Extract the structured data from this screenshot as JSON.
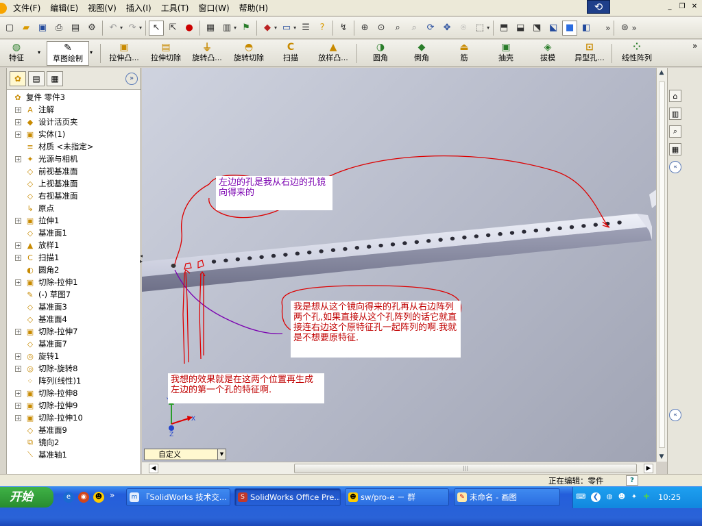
{
  "menubar": {
    "items": [
      "文件(F)",
      "编辑(E)",
      "视图(V)",
      "插入(I)",
      "工具(T)",
      "窗口(W)",
      "帮助(H)"
    ]
  },
  "window": {
    "minimize": "_",
    "restore": "❐",
    "close": "✕"
  },
  "features": {
    "tab_features": "特征",
    "tab_sketch": "草图绘制",
    "extrude_boss": "拉伸凸...",
    "extrude_cut": "拉伸切除",
    "revolve_boss": "旋转凸...",
    "revolve_cut": "旋转切除",
    "sweep": "扫描",
    "loft": "放样凸...",
    "fillet": "圆角",
    "chamfer": "倒角",
    "rib": "筋",
    "shell": "抽壳",
    "draft": "拔模",
    "hole_wizard": "异型孔...",
    "linear_pattern": "线性阵列"
  },
  "tree": {
    "root": "复件 零件3",
    "items": [
      {
        "label": "注解",
        "expand": true,
        "icon": "A"
      },
      {
        "label": "设计活页夹",
        "expand": true,
        "icon": "◆"
      },
      {
        "label": "实体(1)",
        "expand": true,
        "icon": "▣"
      },
      {
        "label": "材质 <未指定>",
        "expand": false,
        "icon": "≡"
      },
      {
        "label": "光源与相机",
        "expand": true,
        "icon": "✦"
      },
      {
        "label": "前视基准面",
        "expand": false,
        "icon": "◇"
      },
      {
        "label": "上视基准面",
        "expand": false,
        "icon": "◇"
      },
      {
        "label": "右视基准面",
        "expand": false,
        "icon": "◇"
      },
      {
        "label": "原点",
        "expand": false,
        "icon": "↳"
      },
      {
        "label": "拉伸1",
        "expand": true,
        "icon": "▣"
      },
      {
        "label": "基准面1",
        "expand": false,
        "icon": "◇"
      },
      {
        "label": "放样1",
        "expand": true,
        "icon": "▲"
      },
      {
        "label": "扫描1",
        "expand": true,
        "icon": "C"
      },
      {
        "label": "圆角2",
        "expand": false,
        "icon": "◐"
      },
      {
        "label": "切除-拉伸1",
        "expand": true,
        "icon": "▣"
      },
      {
        "label": "(-) 草图7",
        "expand": false,
        "icon": "✎"
      },
      {
        "label": "基准面3",
        "expand": false,
        "icon": "◇"
      },
      {
        "label": "基准面4",
        "expand": false,
        "icon": "◇"
      },
      {
        "label": "切除-拉伸7",
        "expand": true,
        "icon": "▣"
      },
      {
        "label": "基准面7",
        "expand": false,
        "icon": "◇"
      },
      {
        "label": "旋转1",
        "expand": true,
        "icon": "◎"
      },
      {
        "label": "切除-旋转8",
        "expand": true,
        "icon": "◎"
      },
      {
        "label": "阵列(线性)1",
        "expand": false,
        "icon": "⁘"
      },
      {
        "label": "切除-拉伸8",
        "expand": true,
        "icon": "▣"
      },
      {
        "label": "切除-拉伸9",
        "expand": true,
        "icon": "▣"
      },
      {
        "label": "切除-拉伸10",
        "expand": true,
        "icon": "▣"
      },
      {
        "label": "基准面9",
        "expand": false,
        "icon": "◇"
      },
      {
        "label": "镜向2",
        "expand": false,
        "icon": "⧉"
      },
      {
        "label": "基准轴1",
        "expand": false,
        "icon": "⟍"
      }
    ]
  },
  "annotations": {
    "note1": "左边的孔是我从右边的孔镜向得来的",
    "note2": "我是想从这个镜向得来的孔再从右边阵列两个孔,如果直接从这个孔阵列的话它就直接连右边这个原特征孔一起阵列的啊.我就是不想要原特征.",
    "note3": "我想的效果就是在这两个位置再生成左边的第一个孔的特征啊."
  },
  "triad": {
    "x": "X",
    "y": "Y",
    "z": "Z"
  },
  "viewport": {
    "view_dropdown": "自定义"
  },
  "status": {
    "editing": "正在编辑：零件",
    "help": "?"
  },
  "taskbar": {
    "start": "开始",
    "tasks": [
      "『SolidWorks 技术交...",
      "SolidWorks Office Pre...",
      "sw/pro-e － 群",
      "未命名 - 画图"
    ],
    "clock": "10:25"
  },
  "colors": {
    "annotation_red": "#c00000",
    "annotation_purple": "#7a00b0",
    "viewport_bg": "#b9bdcc",
    "taskbar_blue": "#245edb",
    "start_green": "#3fb246"
  }
}
